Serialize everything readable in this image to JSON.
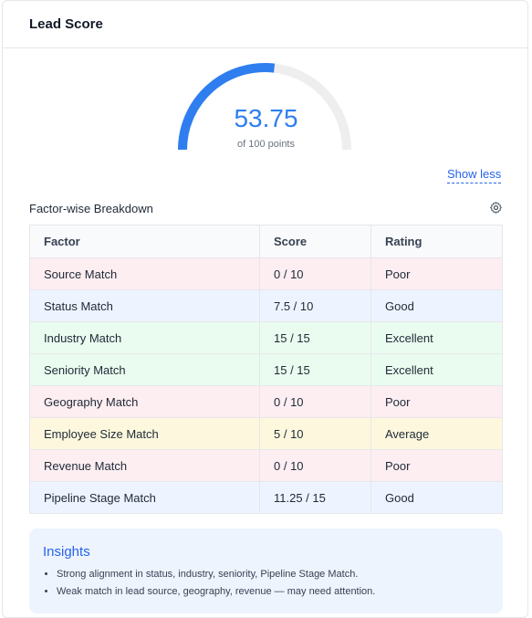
{
  "header": {
    "title": "Lead Score"
  },
  "score": {
    "value": "53.75",
    "subtitle": "of 100 points",
    "fraction": 0.5375
  },
  "colors": {
    "accent": "#2f7ef0",
    "track": "#eeeeee",
    "poor": "#fdeef1",
    "good": "#eef4ff",
    "excellent": "#eafcef",
    "average": "#fdf8dd"
  },
  "controls": {
    "show_less": "Show less"
  },
  "breakdown": {
    "title": "Factor-wise Breakdown",
    "settings_icon": "gear-icon",
    "columns": [
      "Factor",
      "Score",
      "Rating"
    ],
    "rows": [
      {
        "factor": "Source Match",
        "score": "0 / 10",
        "rating": "Poor"
      },
      {
        "factor": "Status Match",
        "score": "7.5 / 10",
        "rating": "Good"
      },
      {
        "factor": "Industry Match",
        "score": "15 / 15",
        "rating": "Excellent"
      },
      {
        "factor": "Seniority Match",
        "score": "15 / 15",
        "rating": "Excellent"
      },
      {
        "factor": "Geography Match",
        "score": "0 / 10",
        "rating": "Poor"
      },
      {
        "factor": "Employee Size Match",
        "score": "5 / 10",
        "rating": "Average"
      },
      {
        "factor": "Revenue Match",
        "score": "0 / 10",
        "rating": "Poor"
      },
      {
        "factor": "Pipeline Stage Match",
        "score": "11.25 / 15",
        "rating": "Good"
      }
    ]
  },
  "insights": {
    "title": "Insights",
    "items": [
      "Strong alignment in status, industry, seniority, Pipeline Stage Match.",
      "Weak match in lead source, geography, revenue — may need attention."
    ]
  }
}
